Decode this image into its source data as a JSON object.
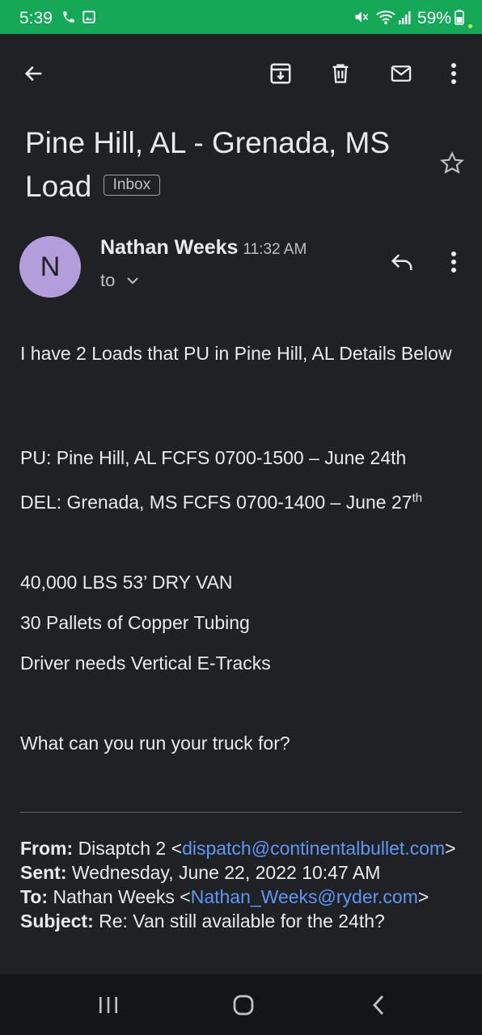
{
  "status_bar": {
    "time": "5:39",
    "battery": "59%",
    "icons": [
      "phone-icon",
      "image-icon",
      "mute-icon",
      "wifi-icon",
      "signal-icon",
      "battery-icon"
    ],
    "background_color": "#15a957"
  },
  "toolbar": {
    "icons": [
      "back-arrow-icon",
      "archive-icon",
      "delete-icon",
      "mark-unread-icon",
      "more-vert-icon"
    ]
  },
  "email": {
    "subject": "Pine Hill, AL - Grenada, MS Load",
    "label": "Inbox",
    "sender": "Nathan Weeks",
    "sender_initial": "N",
    "time": "11:32 AM",
    "to": "to",
    "avatar_color": "#b39ddb",
    "body": {
      "line1": "I have 2 Loads that PU in Pine Hill, AL Details Below",
      "pu": "PU: Pine Hill, AL FCFS 0700-1500 – June 24th",
      "del_main": "DEL: Grenada, MS FCFS 0700-1400 – June 27",
      "del_sup": "th",
      "weight": "40,000 LBS 53’ DRY VAN",
      "pallets": "30 Pallets of Copper Tubing",
      "equipment": "Driver needs Vertical E-Tracks",
      "question": "What can you run your truck for?"
    },
    "quoted": {
      "from_label": "From:",
      "from_name": "Disaptch 2 <",
      "from_email": "dispatch@continentalbullet.com",
      "from_close": ">",
      "sent_label": "Sent:",
      "sent_value": "Wednesday, June 22, 2022 10:47 AM",
      "to_label": "To:",
      "to_name": "Nathan Weeks <",
      "to_email": "Nathan_Weeks@ryder.com",
      "to_close": ">",
      "subject_label": "Subject:",
      "subject_value": "Re: Van still available for the 24th?"
    }
  },
  "nav_bar": {
    "icons": [
      "recent-apps-icon",
      "home-icon",
      "nav-back-icon"
    ]
  },
  "colors": {
    "background": "#1f2124",
    "link": "#5e97f6",
    "nav_bar": "#141517"
  }
}
